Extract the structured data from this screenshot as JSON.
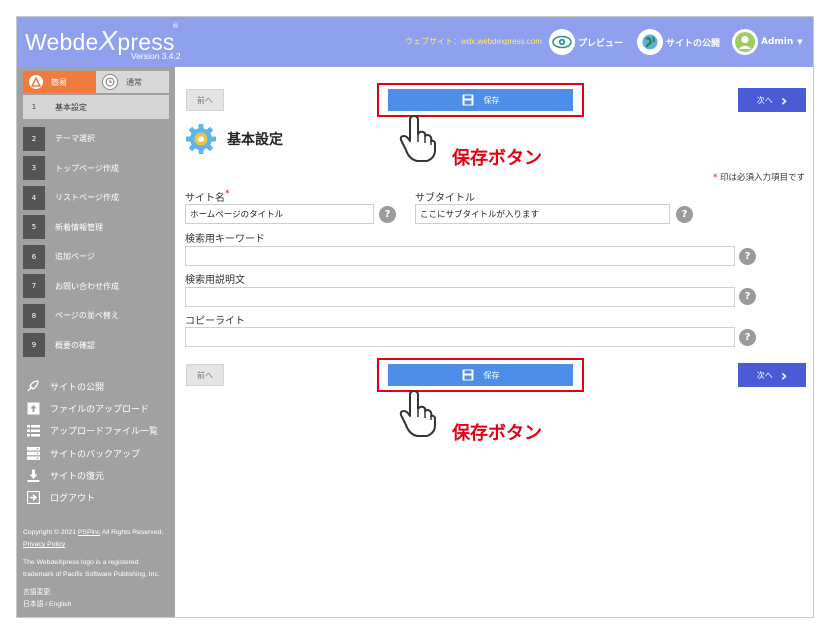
{
  "header": {
    "logo_text": "Webde",
    "logo_x": "X",
    "logo_tail": "press",
    "registered": "®",
    "version": "Version 3.4.2",
    "site_url": "ウェブサイト：wdx.webdexpress.com",
    "preview_label": "プレビュー",
    "publish_label": "サイトの公開",
    "admin_label": "Admin"
  },
  "sidebar": {
    "mode_simple": "簡易",
    "mode_normal": "通常",
    "steps": [
      {
        "num": "1",
        "label": "基本設定"
      },
      {
        "num": "2",
        "label": "テーマ選択"
      },
      {
        "num": "3",
        "label": "トップページ作成"
      },
      {
        "num": "4",
        "label": "リストページ作成"
      },
      {
        "num": "5",
        "label": "新着情報管理"
      },
      {
        "num": "6",
        "label": "追加ページ"
      },
      {
        "num": "7",
        "label": "お問い合わせ作成"
      },
      {
        "num": "8",
        "label": "ページの並べ替え"
      },
      {
        "num": "9",
        "label": "概要の確認"
      }
    ],
    "tools": [
      {
        "label": "サイトの公開",
        "icon": "rocket-icon"
      },
      {
        "label": "ファイルのアップロード",
        "icon": "upload-icon"
      },
      {
        "label": "アップロードファイル一覧",
        "icon": "list-icon"
      },
      {
        "label": "サイトのバックアップ",
        "icon": "backup-icon"
      },
      {
        "label": "サイトの復元",
        "icon": "download-icon"
      },
      {
        "label": "ログアウト",
        "icon": "logout-icon"
      }
    ],
    "footer": {
      "copyright_prefix": "Copyright © 2021 ",
      "company": "PSPinc",
      "rights": " All Rights Reserved. ",
      "privacy": "Privacy Policy",
      "trademark": "The WebdeXpress logo is a registered trademark of Pacific Software Publishing, Inc.",
      "language_label": "言語変更:",
      "languages": "日本語 / English"
    }
  },
  "main": {
    "prev_label": "前へ",
    "save_label": "保存",
    "next_label": "次へ",
    "annotation": "保存ボタン",
    "section_title": "基本設定",
    "required_note_star": "*",
    "required_note": " 印は必須入力項目です",
    "fields": {
      "site_name_label": "サイト名",
      "site_name_value": "ホームページのタイトル",
      "subtitle_label": "サブタイトル",
      "subtitle_value": "ここにサブタイトルが入ります",
      "keywords_label": "検索用キーワード",
      "description_label": "検索用説明文",
      "copyright_label": "コピーライト",
      "required_star": "*",
      "help": "?"
    }
  },
  "colors": {
    "header_bg": "#8ea0ee",
    "sidebar_bg": "#a1a1a1",
    "accent_orange": "#ef7b3e",
    "save_blue": "#4d8fe8",
    "next_blue": "#4a5bd8",
    "annotation_red": "#e60012"
  }
}
